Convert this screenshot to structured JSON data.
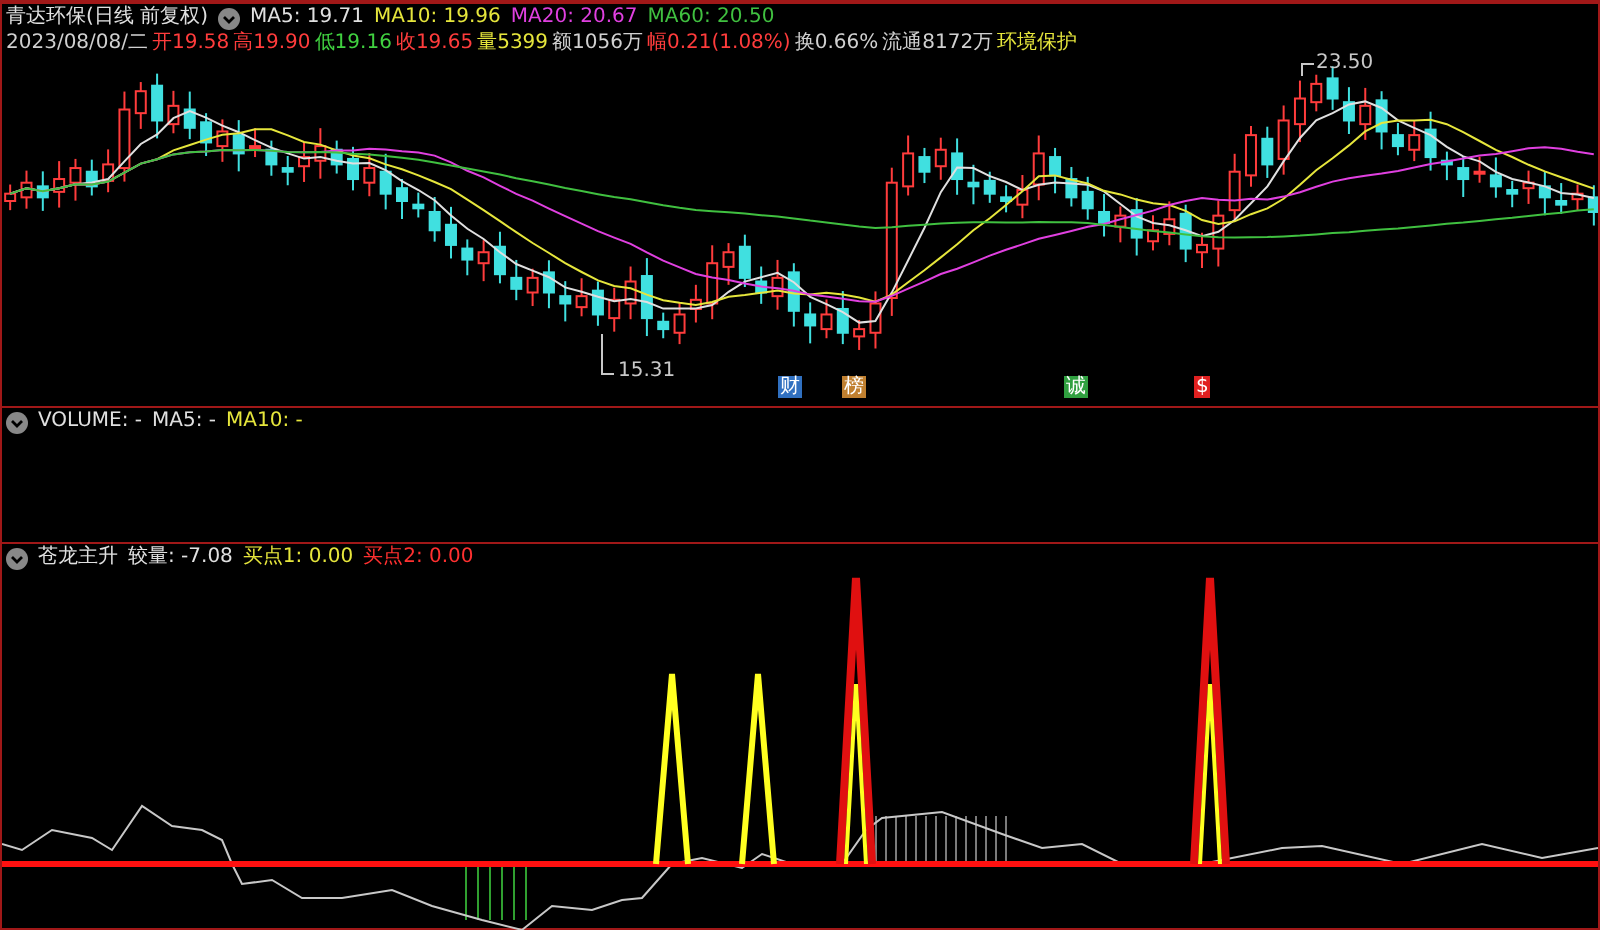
{
  "main_panel": {
    "title": "青达环保(日线 前复权)",
    "ma": [
      {
        "label": "MA5:",
        "value": "19.71",
        "color": "#e0e0e0"
      },
      {
        "label": "MA10:",
        "value": "19.96",
        "color": "#e6e63c"
      },
      {
        "label": "MA20:",
        "value": "20.67",
        "color": "#e040e0"
      },
      {
        "label": "MA60:",
        "value": "20.50",
        "color": "#40c040"
      }
    ],
    "quote": [
      {
        "text": "2023/08/08/二",
        "color": "#d0d0d0"
      },
      {
        "text": "开19.58",
        "color": "#ff3c3c"
      },
      {
        "text": "高19.90",
        "color": "#ff3c3c"
      },
      {
        "text": "低19.16",
        "color": "#40d040"
      },
      {
        "text": "收19.65",
        "color": "#ff3c3c"
      },
      {
        "text": "量5399",
        "color": "#e6e63c"
      },
      {
        "text": "额1056万",
        "color": "#d0d0d0"
      },
      {
        "text": "幅0.21(1.08%)",
        "color": "#ff3c3c"
      },
      {
        "text": "换0.66%",
        "color": "#d0d0d0"
      },
      {
        "text": "流通8172万",
        "color": "#d0d0d0"
      },
      {
        "text": "环境保护",
        "color": "#e6e63c"
      }
    ],
    "high_label": "23.50",
    "low_label": "15.31",
    "markers": [
      {
        "text": "财",
        "color": "#3070c0"
      },
      {
        "text": "榜",
        "color": "#c08030"
      },
      {
        "text": "诚",
        "color": "#30a040"
      },
      {
        "text": "$",
        "color": "#e02020"
      }
    ]
  },
  "volume_panel": {
    "items": [
      {
        "text": "VOLUME: -",
        "color": "#e0e0e0"
      },
      {
        "text": "MA5: -",
        "color": "#e0e0e0"
      },
      {
        "text": "MA10: -",
        "color": "#e6e63c"
      }
    ]
  },
  "indicator_panel": {
    "items": [
      {
        "text": "苍龙主升",
        "color": "#e0e0e0"
      },
      {
        "text": "较量: -7.08",
        "color": "#e0e0e0"
      },
      {
        "text": "买点1: 0.00",
        "color": "#e6e63c"
      },
      {
        "text": "买点2: 0.00",
        "color": "#ff3030"
      }
    ]
  }
}
